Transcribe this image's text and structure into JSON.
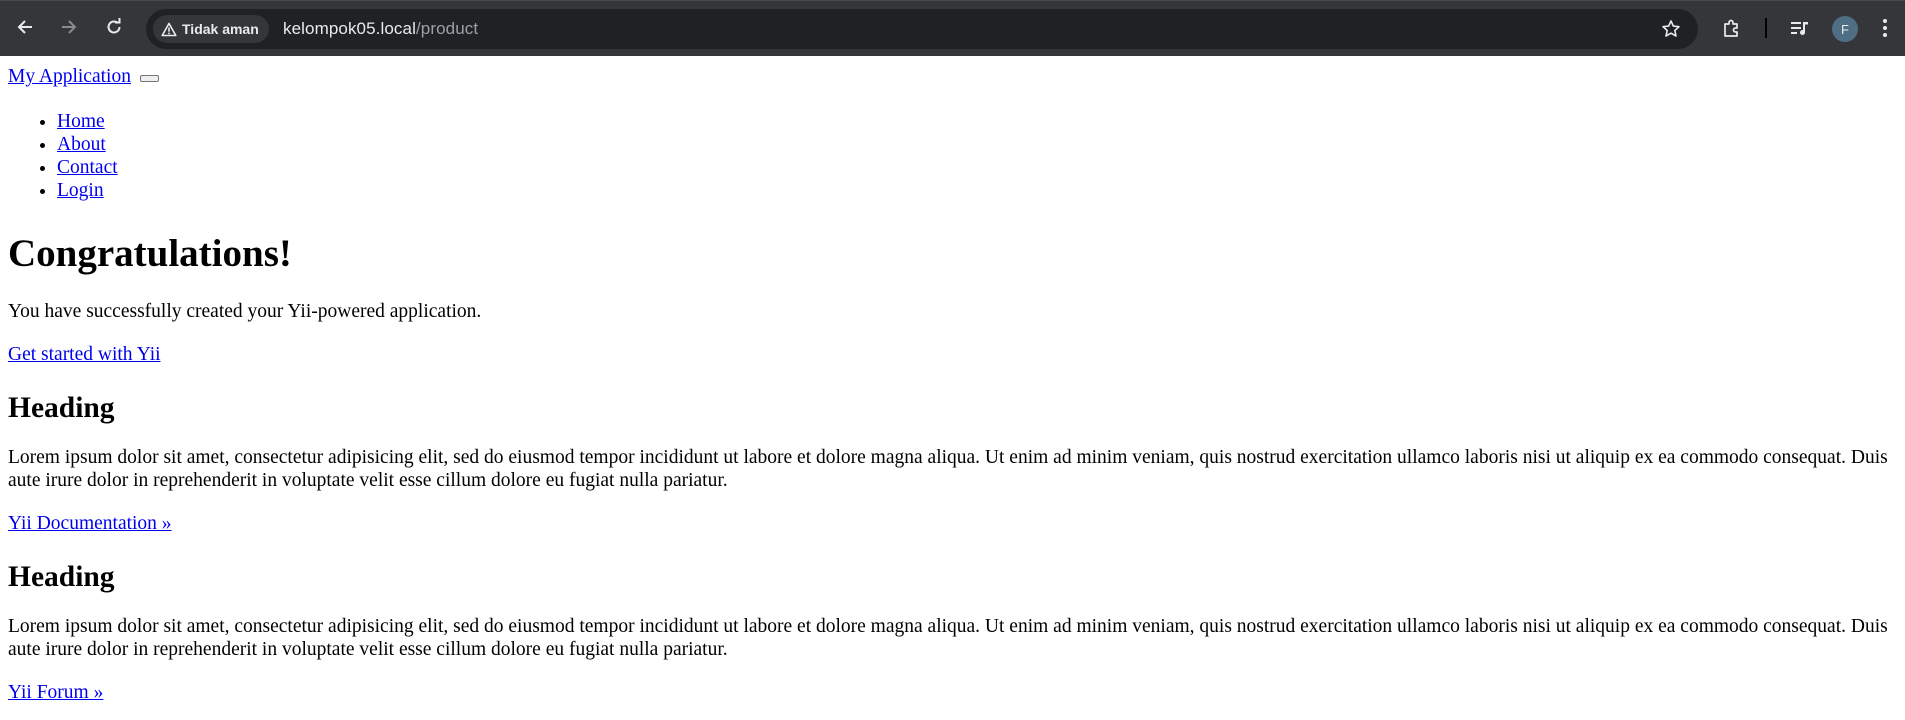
{
  "browser": {
    "security_label": "Tidak aman",
    "url_host": "kelompok05.local",
    "url_path": "/product",
    "profile_initial": "F"
  },
  "site": {
    "brand": "My Application",
    "nav": [
      {
        "label": "Home"
      },
      {
        "label": "About"
      },
      {
        "label": "Contact"
      },
      {
        "label": "Login"
      }
    ]
  },
  "jumbotron": {
    "title": "Congratulations!",
    "lead": "You have successfully created your Yii-powered application.",
    "cta": "Get started with Yii"
  },
  "sections": [
    {
      "heading": "Heading",
      "text": "Lorem ipsum dolor sit amet, consectetur adipisicing elit, sed do eiusmod tempor incididunt ut labore et dolore magna aliqua. Ut enim ad minim veniam, quis nostrud exercitation ullamco laboris nisi ut aliquip ex ea commodo consequat. Duis aute irure dolor in reprehenderit in voluptate velit esse cillum dolore eu fugiat nulla pariatur.",
      "link": "Yii Documentation »"
    },
    {
      "heading": "Heading",
      "text": "Lorem ipsum dolor sit amet, consectetur adipisicing elit, sed do eiusmod tempor incididunt ut labore et dolore magna aliqua. Ut enim ad minim veniam, quis nostrud exercitation ullamco laboris nisi ut aliquip ex ea commodo consequat. Duis aute irure dolor in reprehenderit in voluptate velit esse cillum dolore eu fugiat nulla pariatur.",
      "link": "Yii Forum »"
    }
  ]
}
